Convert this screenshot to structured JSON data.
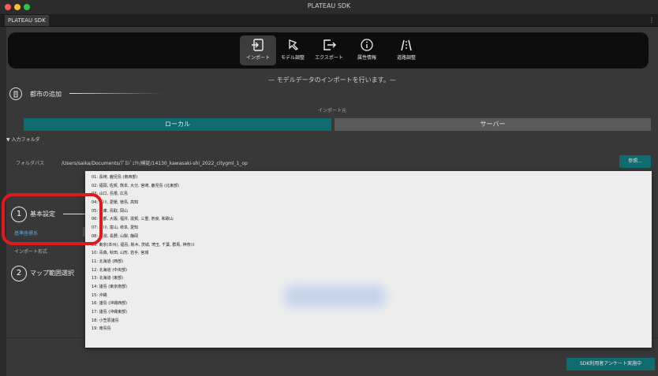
{
  "window": {
    "title": "PLATEAU SDK",
    "tab": "PLATEAU SDK",
    "tab_more": "⋮"
  },
  "toolbar": {
    "items": [
      {
        "label": "インポート",
        "icon": "import-icon",
        "active": true
      },
      {
        "label": "モデル調整",
        "icon": "model-adjust-icon"
      },
      {
        "label": "エクスポート",
        "icon": "export-icon"
      },
      {
        "label": "属性情報",
        "icon": "info-icon"
      },
      {
        "label": "道路調整",
        "icon": "road-icon"
      }
    ]
  },
  "subtitle": "— モデルデータのインポートを行います。—",
  "city_section": {
    "label": "都市の追加",
    "icon": "city-add-icon"
  },
  "import_source": {
    "label": "インポート元",
    "local": "ローカル",
    "server": "サーバー",
    "selected": "ローカル"
  },
  "folder": {
    "heading": "▼ 入力フォルダ",
    "label": "フォルダパス",
    "path": "/Users/saika/Documents/ﾌﾟﾛｼﾞｪｸﾄ/検証/14130_kawasaki-shi_2022_citygml_1_op",
    "browse": "参照..."
  },
  "settings": {
    "step1_num": "1",
    "step1_label": "基本設定",
    "crs_label": "基準座標系",
    "format_label": "インポート形式",
    "step2_num": "2",
    "step2_label": "マップ範囲選択"
  },
  "dropdown": {
    "selected_index": 8,
    "options": [
      "01: 長崎, 鹿児島 (南西部)",
      "02: 福岡, 佐賀, 熊本, 大分, 宮崎, 鹿児島 (北東部)",
      "03: 山口, 島根, 広島",
      "04: 香川, 愛媛, 徳島, 高知",
      "05: 兵庫, 鳥取, 岡山",
      "06: 京都, 大阪, 福井, 滋賀, 三重, 奈良, 和歌山",
      "07: 石川, 富山, 岐阜, 愛知",
      "08: 新潟, 長野, 山梨, 静岡",
      "09: 東京(本州), 福島, 栃木, 茨城, 埼玉, 千葉, 群馬, 神奈川",
      "10: 青森, 秋田, 山形, 岩手, 宮城",
      "11: 北海道 (西部)",
      "12: 北海道 (中央部)",
      "13: 北海道 (東部)",
      "14: 諸島 (東京南部)",
      "15: 沖縄",
      "16: 諸島 (沖縄西部)",
      "17: 諸島 (沖縄東部)",
      "18: 小笠原諸島",
      "19: 南鳥島"
    ]
  },
  "footer": {
    "survey": "SDK利用者アンケート実施中"
  },
  "colors": {
    "accent": "#0e6b6f",
    "highlight": "#e01a1a",
    "link": "#4fa8e0"
  }
}
